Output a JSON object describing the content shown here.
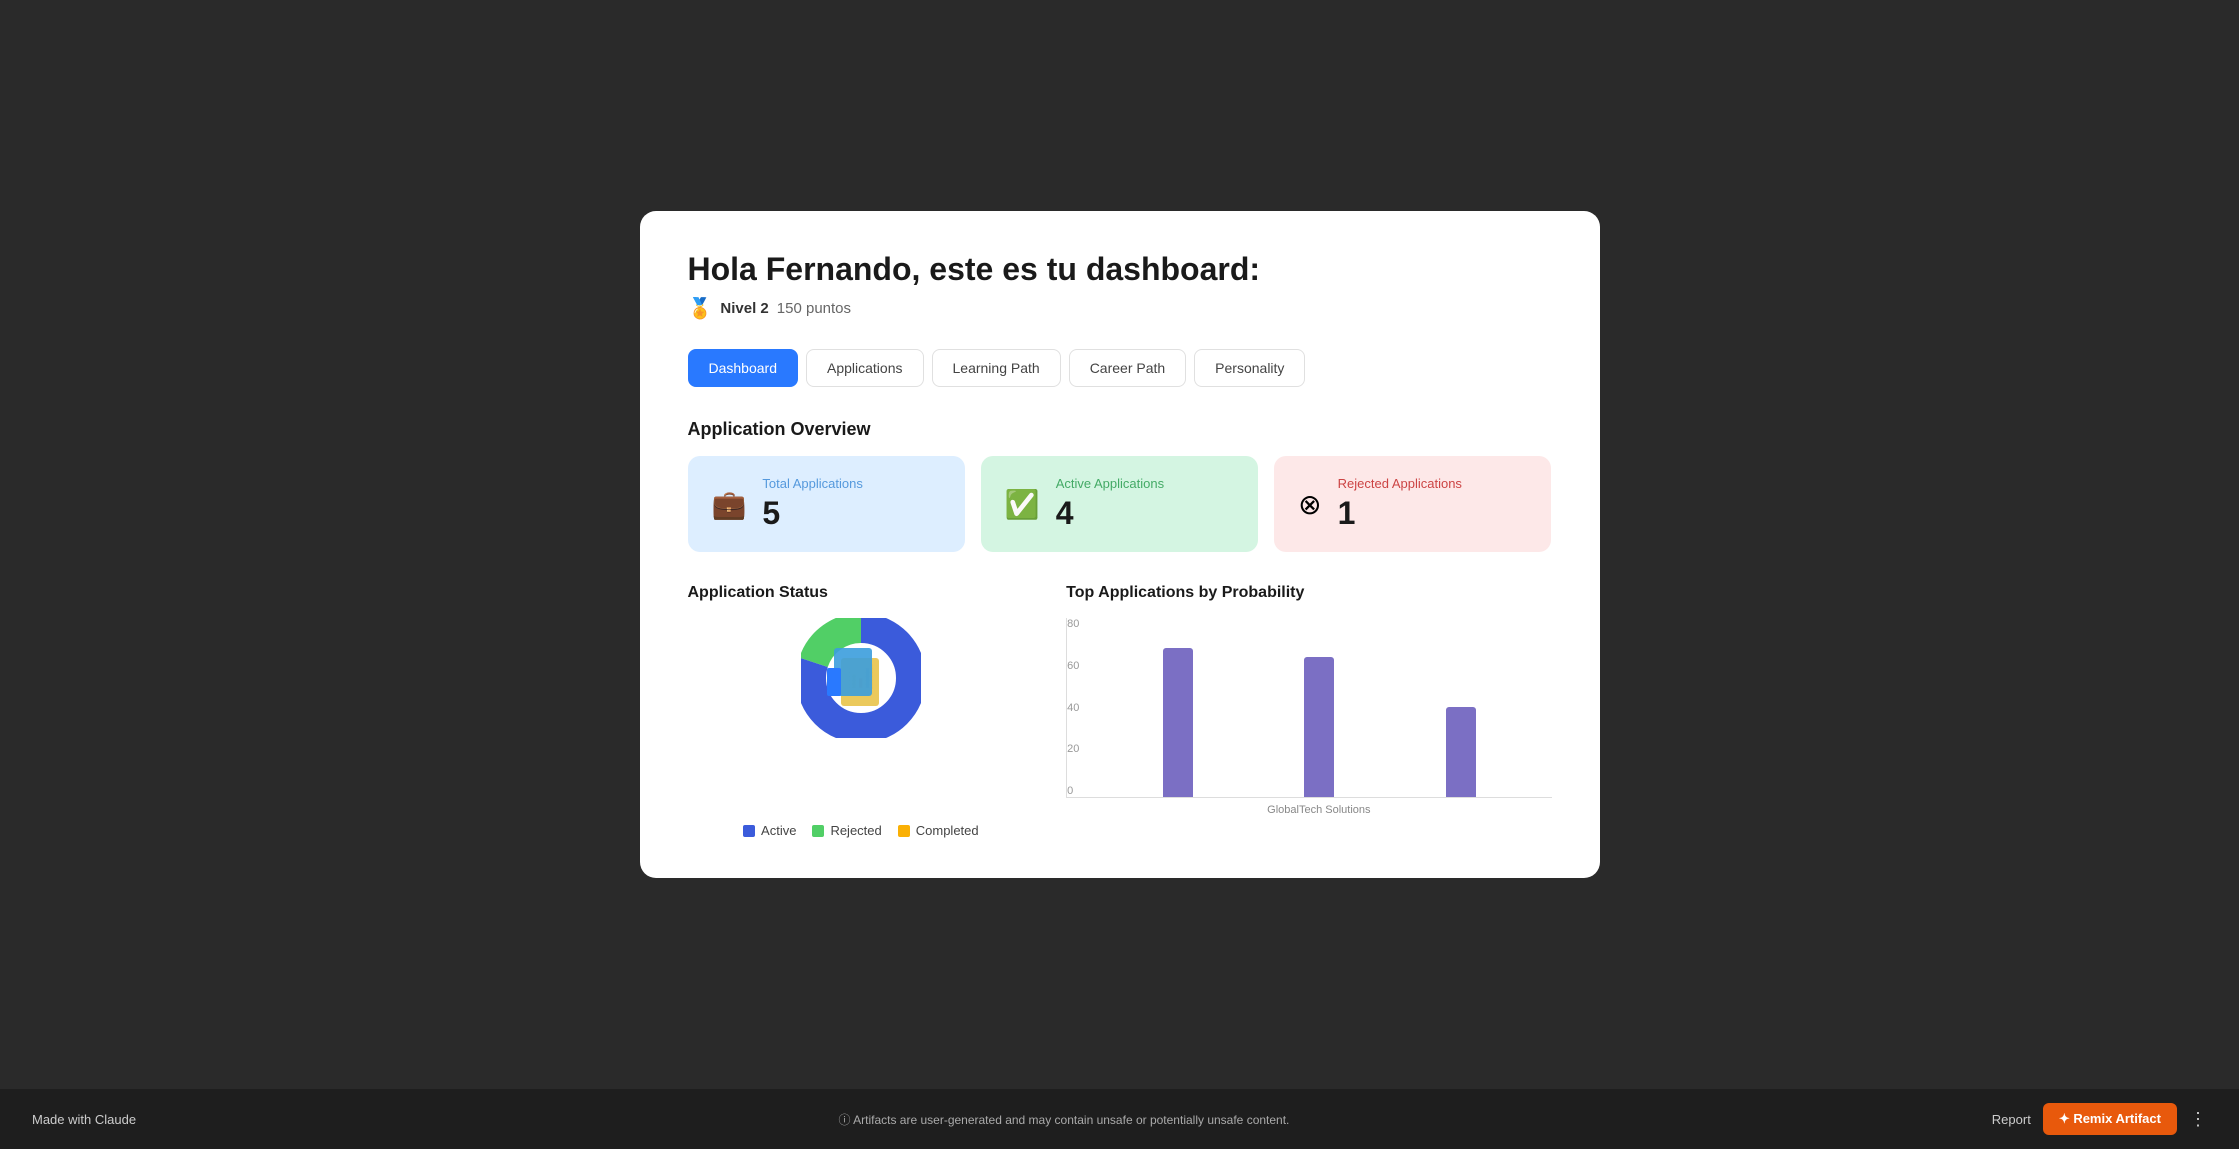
{
  "header": {
    "greeting": "Hola Fernando, este es tu dashboard:",
    "level_label": "Nivel 2",
    "points_label": "150 puntos"
  },
  "tabs": [
    {
      "id": "dashboard",
      "label": "Dashboard",
      "active": true
    },
    {
      "id": "applications",
      "label": "Applications"
    },
    {
      "id": "learning-path",
      "label": "Learning Path"
    },
    {
      "id": "career-path",
      "label": "Career Path"
    },
    {
      "id": "personality",
      "label": "Personality"
    }
  ],
  "application_overview": {
    "title": "Application Overview",
    "cards": [
      {
        "id": "total",
        "label": "Total Applications",
        "value": "5",
        "type": "blue"
      },
      {
        "id": "active",
        "label": "Active Applications",
        "value": "4",
        "type": "green"
      },
      {
        "id": "rejected",
        "label": "Rejected Applications",
        "value": "1",
        "type": "red"
      }
    ]
  },
  "application_status": {
    "title": "Application Status",
    "legend": [
      {
        "label": "Active",
        "color": "#3b5bdb"
      },
      {
        "label": "Rejected",
        "color": "#51cf66"
      },
      {
        "label": "Completed",
        "color": "#fab005"
      }
    ],
    "pie": {
      "active_deg": 288,
      "rejected_deg": 72,
      "completed_deg": 0
    }
  },
  "top_applications": {
    "title": "Top Applications by Probability",
    "y_labels": [
      "0",
      "20",
      "40",
      "60",
      "80"
    ],
    "bars": [
      {
        "label": "GlobalTech",
        "value": 83,
        "max": 100
      },
      {
        "label": "Solutions",
        "value": 78,
        "max": 100
      },
      {
        "label": "",
        "value": 50,
        "max": 100
      }
    ],
    "x_label": "GlobalTech Solutions"
  },
  "footer": {
    "made_with": "Made with Claude",
    "disclaimer": "ⓘ Artifacts are user-generated and may contain unsafe or potentially unsafe content.",
    "report_label": "Report",
    "remix_label": "✦ Remix Artifact"
  }
}
